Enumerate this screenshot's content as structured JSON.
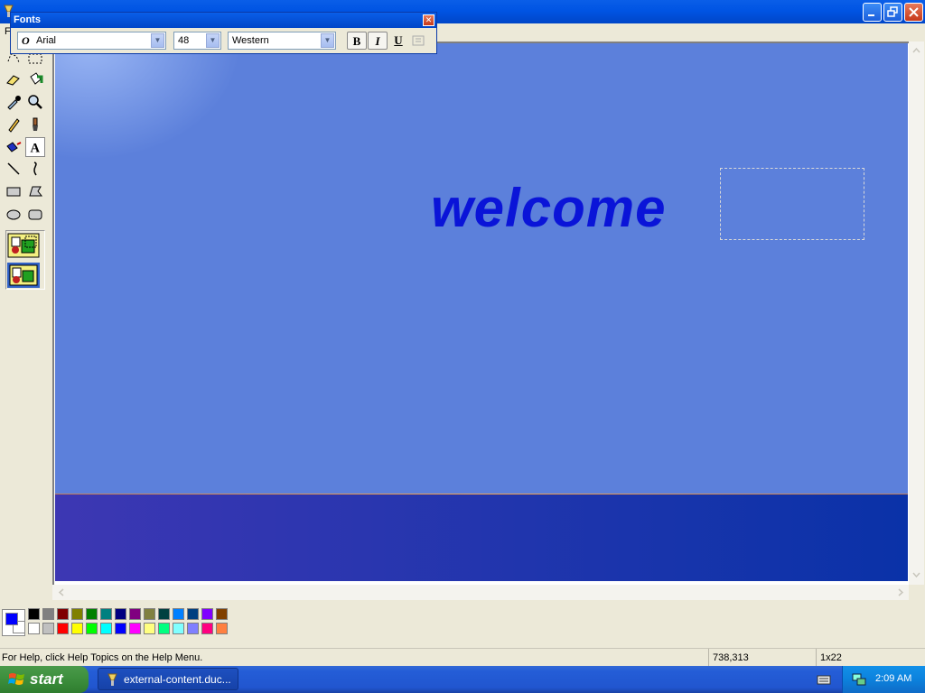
{
  "window": {
    "app_icon": "paint-brush-icon",
    "minimize_icon": "minimize-icon",
    "restore_icon": "restore-icon",
    "close_icon": "close-icon"
  },
  "menu": {
    "file_label": "F"
  },
  "toolbox": {
    "tools": [
      "free-select-icon",
      "rect-select-icon",
      "eraser-icon",
      "fill-bucket-icon",
      "eyedropper-icon",
      "magnifier-icon",
      "pencil-icon",
      "brush-icon",
      "airbrush-icon",
      "text-icon",
      "line-icon",
      "curve-icon",
      "rectangle-icon",
      "polygon-icon",
      "ellipse-icon",
      "rounded-rect-icon"
    ],
    "selected_tool": "text-icon",
    "options": [
      "opaque-background-icon",
      "transparent-background-icon"
    ]
  },
  "canvas": {
    "text": "welcome",
    "text_color": "#0a14d8",
    "background_color": "#5c80db",
    "band_color": "#2035ad"
  },
  "fonts_toolbar": {
    "title": "Fonts",
    "font_name": "Arial",
    "font_size": "48",
    "script": "Western",
    "bold_label": "B",
    "italic_label": "I",
    "underline_label": "U",
    "font_type_icon": "opentype-icon",
    "vertical_text_icon": "vertical-text-icon",
    "close_icon": "close-icon"
  },
  "palette": {
    "foreground": "#0000ff",
    "background": "#ffffff",
    "row1": [
      "#000000",
      "#808080",
      "#800000",
      "#808000",
      "#008000",
      "#008080",
      "#000080",
      "#800080",
      "#808040",
      "#004040",
      "#0080ff",
      "#004080",
      "#8000ff",
      "#804000"
    ],
    "row2": [
      "#ffffff",
      "#c0c0c0",
      "#ff0000",
      "#ffff00",
      "#00ff00",
      "#00ffff",
      "#0000ff",
      "#ff00ff",
      "#ffff80",
      "#00ff80",
      "#80ffff",
      "#8080ff",
      "#ff0080",
      "#ff8040"
    ]
  },
  "status": {
    "help_text": "For Help, click Help Topics on the Help Menu.",
    "coords": "738,313",
    "size": "1x22"
  },
  "taskbar": {
    "start_label": "start",
    "task_label": "external-content.duc...",
    "clock": "2:09 AM",
    "tray_icons": [
      "keyboard-icon",
      "network-icon"
    ]
  }
}
